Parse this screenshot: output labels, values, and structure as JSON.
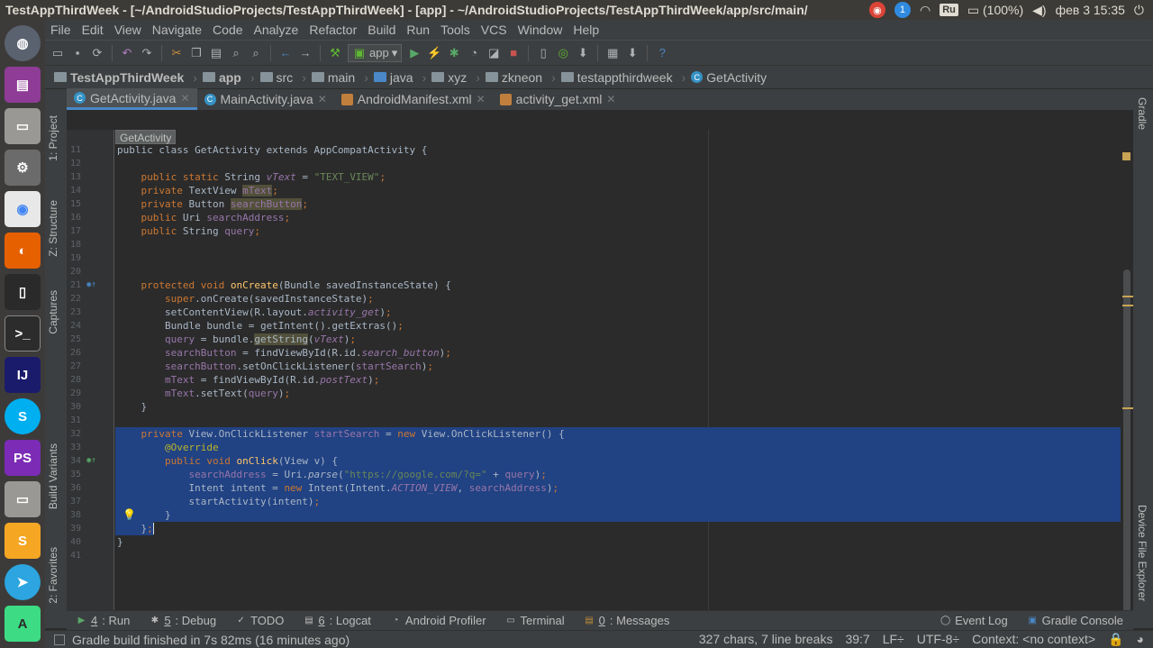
{
  "system": {
    "window_title": "TestAppThirdWeek - [~/AndroidStudioProjects/TestAppThirdWeek] - [app] - ~/AndroidStudioProjects/TestAppThirdWeek/app/src/main/",
    "keyboard_layout": "Ru",
    "battery": "(100%)",
    "datetime": "фев 3 15:35"
  },
  "menu": [
    "File",
    "Edit",
    "View",
    "Navigate",
    "Code",
    "Analyze",
    "Refactor",
    "Build",
    "Run",
    "Tools",
    "VCS",
    "Window",
    "Help"
  ],
  "run_config": "app",
  "breadcrumbs": [
    "TestAppThirdWeek",
    "app",
    "src",
    "main",
    "java",
    "xyz",
    "zkneon",
    "testappthirdweek",
    "GetActivity"
  ],
  "tabs": [
    {
      "label": "GetActivity.java",
      "active": true
    },
    {
      "label": "MainActivity.java",
      "active": false
    },
    {
      "label": "AndroidManifest.xml",
      "active": false
    },
    {
      "label": "activity_get.xml",
      "active": false
    }
  ],
  "editor_crumb": "GetActivity",
  "left_tools": [
    "1: Project",
    "Z: Structure",
    "Captures",
    "Build Variants",
    "2: Favorites"
  ],
  "right_tools": [
    "Gradle",
    "Device File Explorer"
  ],
  "code_lines": [
    {
      "n": "11",
      "text": "public class GetActivity extends AppCompatActivity {"
    },
    {
      "n": "12",
      "text": ""
    },
    {
      "n": "13",
      "text": "    public static String vText = \"TEXT_VIEW\";"
    },
    {
      "n": "14",
      "text": "    private TextView mText;"
    },
    {
      "n": "15",
      "text": "    private Button searchButton;"
    },
    {
      "n": "16",
      "text": "    public Uri searchAddress;"
    },
    {
      "n": "17",
      "text": "    public String query;"
    },
    {
      "n": "18",
      "text": ""
    },
    {
      "n": "19",
      "text": ""
    },
    {
      "n": "20",
      "text": ""
    },
    {
      "n": "21",
      "text": "    protected void onCreate(Bundle savedInstanceState) {"
    },
    {
      "n": "22",
      "text": "        super.onCreate(savedInstanceState);"
    },
    {
      "n": "23",
      "text": "        setContentView(R.layout.activity_get);"
    },
    {
      "n": "24",
      "text": "        Bundle bundle = getIntent().getExtras();"
    },
    {
      "n": "25",
      "text": "        query = bundle.getString(vText);"
    },
    {
      "n": "26",
      "text": "        searchButton = findViewById(R.id.search_button);"
    },
    {
      "n": "27",
      "text": "        searchButton.setOnClickListener(startSearch);"
    },
    {
      "n": "28",
      "text": "        mText = findViewById(R.id.postText);"
    },
    {
      "n": "29",
      "text": "        mText.setText(query);"
    },
    {
      "n": "30",
      "text": "    }"
    },
    {
      "n": "31",
      "text": ""
    },
    {
      "n": "32",
      "text": "    private View.OnClickListener startSearch = new View.OnClickListener() {"
    },
    {
      "n": "33",
      "text": "        @Override"
    },
    {
      "n": "34",
      "text": "        public void onClick(View v) {"
    },
    {
      "n": "35",
      "text": "            searchAddress = Uri.parse(\"https://google.com/?q=\" + query);"
    },
    {
      "n": "36",
      "text": "            Intent intent = new Intent(Intent.ACTION_VIEW, searchAddress);"
    },
    {
      "n": "37",
      "text": "            startActivity(intent);"
    },
    {
      "n": "38",
      "text": "        }"
    },
    {
      "n": "39",
      "text": "    };"
    },
    {
      "n": "40",
      "text": "}"
    },
    {
      "n": "41",
      "text": ""
    }
  ],
  "bottom_tabs": [
    {
      "num": "4",
      "label": ": Run"
    },
    {
      "num": "5",
      "label": ": Debug"
    },
    {
      "num": "",
      "label": "TODO"
    },
    {
      "num": "6",
      "label": ": Logcat"
    },
    {
      "num": "",
      "label": "Android Profiler"
    },
    {
      "num": "",
      "label": "Terminal"
    },
    {
      "num": "0",
      "label": ": Messages"
    }
  ],
  "bottom_right_tabs": [
    "Event Log",
    "Gradle Console"
  ],
  "status": {
    "message": "Gradle build finished in 7s 82ms (16 minutes ago)",
    "chars": "327 chars, 7 line breaks",
    "position": "39:7",
    "line_sep": "LF÷",
    "encoding": "UTF-8÷",
    "context": "Context: <no context>"
  },
  "colors": {
    "accent": "#4a88c7",
    "selection": "#214283",
    "keyword": "#cc7832",
    "field": "#9876aa",
    "string": "#6a8759"
  }
}
